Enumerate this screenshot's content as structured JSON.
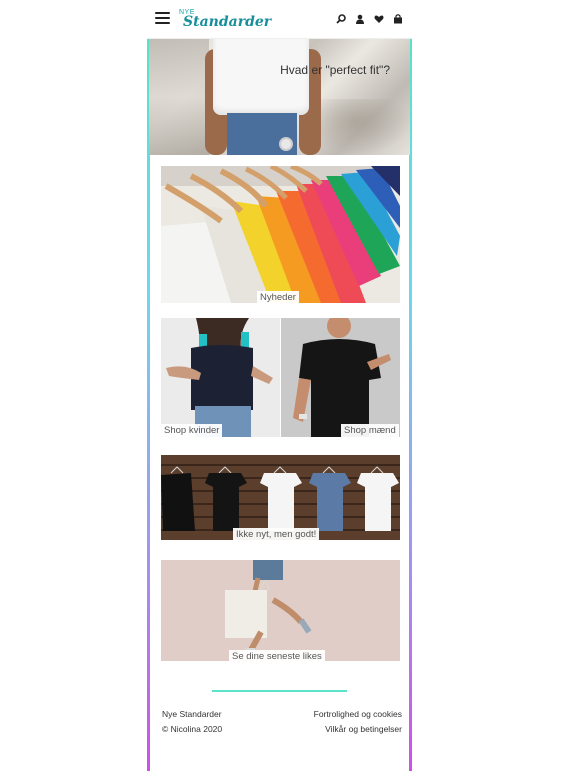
{
  "header": {
    "logo_small": "NYE",
    "logo_main": "Standarder",
    "icons": [
      "menu-icon",
      "search-icon",
      "user-icon",
      "heart-icon",
      "bag-icon"
    ]
  },
  "hero": {
    "title": "Hvad er \"perfect fit\"?"
  },
  "tiles": {
    "news": "Nyheder",
    "women": "Shop kvinder",
    "men": "Shop mænd",
    "not_new": "Ikke nyt, men godt!",
    "likes": "Se dine seneste likes"
  },
  "footer": {
    "brand": "Nye Standarder",
    "copyright": "© Nicolina 2020",
    "privacy": "Fortrolighed og cookies",
    "terms": "Vilkår og betingelser"
  },
  "colors": {
    "accent": "#168f9b",
    "divider": "#5ce3cc",
    "border_top": "#57e3c8",
    "border_bottom": "#d04fe6"
  }
}
